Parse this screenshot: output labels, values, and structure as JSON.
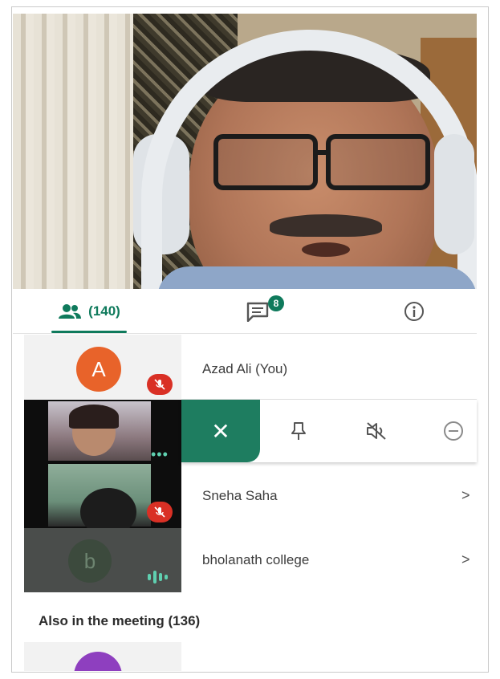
{
  "tabs": {
    "people_count": "(140)",
    "chat_badge": "8"
  },
  "participants": [
    {
      "initial": "A",
      "name": "Azad Ali (You)",
      "avatar_color": "#e8632a"
    },
    {
      "name": "Sneha Saha"
    },
    {
      "initial": "b",
      "name": "bholanath college",
      "avatar_color": "#3c4a3d"
    }
  ],
  "also_in_meeting": "Also in the meeting (136)",
  "colors": {
    "accent": "#0f7a5c",
    "mic_off": "#d93025"
  },
  "icons": [
    "people-icon",
    "chat-icon",
    "info-icon",
    "mic-off-icon",
    "close-icon",
    "pin-icon",
    "mute-icon",
    "remove-icon",
    "chevron-right-icon",
    "audio-wave-icon",
    "more-dots-icon"
  ]
}
